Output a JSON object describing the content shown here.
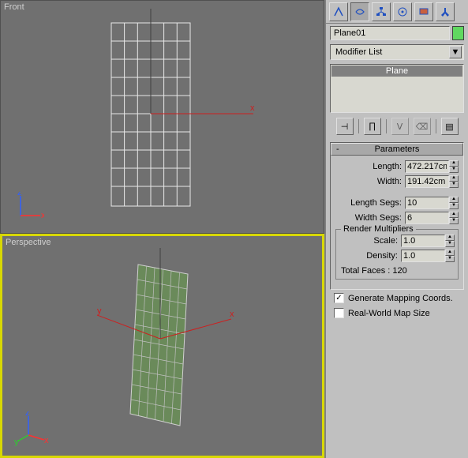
{
  "viewports": {
    "front_label": "Front",
    "perspective_label": "Perspective"
  },
  "object": {
    "name": "Plane01",
    "modifier_list_label": "Modifier List",
    "stack_item": "Plane"
  },
  "toolbar_icons": {
    "arrow": "arrow",
    "arc": "arc",
    "hierarchy": "hierarchy",
    "motion": "motion",
    "display": "display",
    "utilities": "utilities"
  },
  "stack_bar": {
    "pin": "⊣",
    "show": "∏",
    "make_unique": "ᐯ",
    "remove": "⌫",
    "configure": "▤"
  },
  "rollout": {
    "title": "Parameters",
    "length_label": "Length:",
    "length_value": "472.217cm",
    "width_label": "Width:",
    "width_value": "191.42cm",
    "length_segs_label": "Length Segs:",
    "length_segs_value": "10",
    "width_segs_label": "Width Segs:",
    "width_segs_value": "6",
    "render_mult_title": "Render Multipliers",
    "scale_label": "Scale:",
    "scale_value": "1.0",
    "density_label": "Density:",
    "density_value": "1.0",
    "total_faces": "Total Faces : 120",
    "gen_mapping": "Generate Mapping Coords.",
    "real_world": "Real-World Map Size"
  }
}
